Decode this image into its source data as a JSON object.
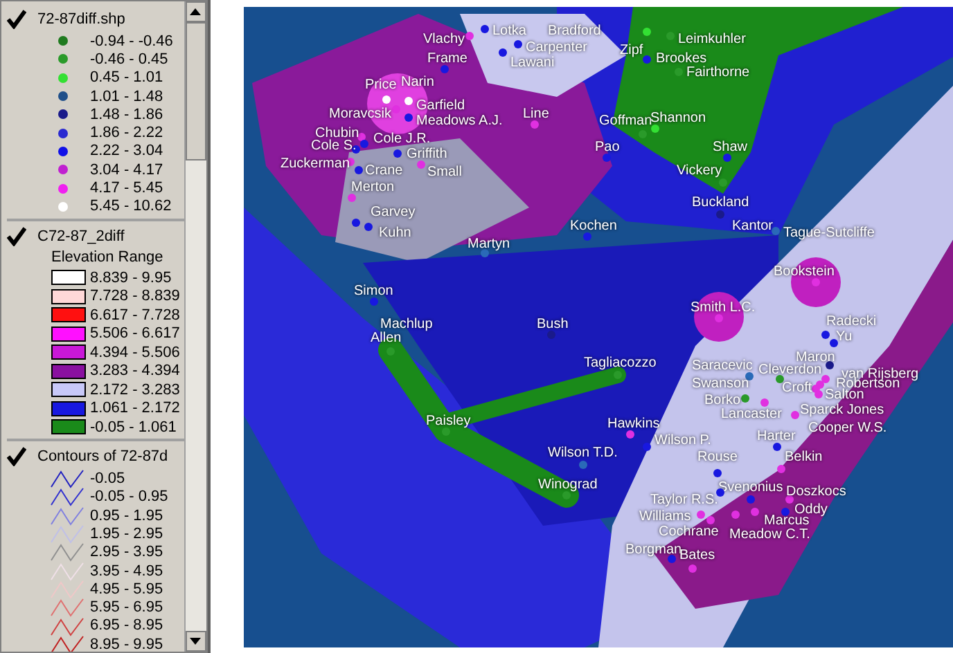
{
  "legend": {
    "layers": [
      {
        "kind": "points",
        "title": "72-87diff.shp",
        "checked": true,
        "items": [
          {
            "label": "-0.94 - -0.46",
            "color": "#1f7a1f"
          },
          {
            "label": "-0.46 - 0.45",
            "color": "#2a9a2a"
          },
          {
            "label": "0.45 - 1.01",
            "color": "#33e033"
          },
          {
            "label": "1.01 - 1.48",
            "color": "#1f4f8a"
          },
          {
            "label": "1.48 - 1.86",
            "color": "#1a1a8a"
          },
          {
            "label": "1.86 - 2.22",
            "color": "#2a2ad0"
          },
          {
            "label": "2.22 - 3.04",
            "color": "#1010e8"
          },
          {
            "label": "3.04 - 4.17",
            "color": "#c020d0"
          },
          {
            "label": "4.17 - 5.45",
            "color": "#f020f0"
          },
          {
            "label": "5.45 - 10.62",
            "color": "#ffffff"
          }
        ]
      },
      {
        "kind": "fills",
        "title": "C72-87_2diff",
        "subtitle": "Elevation Range",
        "checked": true,
        "items": [
          {
            "label": "8.839 - 9.95",
            "color": "#ffffff"
          },
          {
            "label": "7.728 - 8.839",
            "color": "#ffd8d8"
          },
          {
            "label": "6.617 - 7.728",
            "color": "#ff1010"
          },
          {
            "label": "5.506 - 6.617",
            "color": "#ff10ff"
          },
          {
            "label": "4.394 - 5.506",
            "color": "#c818d8"
          },
          {
            "label": "3.283 - 4.394",
            "color": "#8a10a0"
          },
          {
            "label": "2.172 - 3.283",
            "color": "#c8c8f8"
          },
          {
            "label": "1.061 - 2.172",
            "color": "#1818e0"
          },
          {
            "label": "-0.05 - 1.061",
            "color": "#1a8a1a"
          }
        ]
      },
      {
        "kind": "lines",
        "title": "Contours of 72-87d",
        "checked": true,
        "items": [
          {
            "label": "-0.05",
            "color": "#2020c0"
          },
          {
            "label": "-0.05 - 0.95",
            "color": "#3030d0"
          },
          {
            "label": "0.95 - 1.95",
            "color": "#8080e0"
          },
          {
            "label": "1.95 - 2.95",
            "color": "#c0c0e8"
          },
          {
            "label": "2.95 - 3.95",
            "color": "#909090"
          },
          {
            "label": "3.95 - 4.95",
            "color": "#f0e0e8"
          },
          {
            "label": "4.95 - 5.95",
            "color": "#f0c8c8"
          },
          {
            "label": "5.95 - 6.95",
            "color": "#e07070"
          },
          {
            "label": "6.95 - 8.95",
            "color": "#d04040"
          },
          {
            "label": "8.95 - 9.95",
            "color": "#c02020"
          }
        ]
      }
    ]
  },
  "map": {
    "points": [
      {
        "label": "Lotka",
        "color": "#1818e0"
      },
      {
        "label": "Bradford"
      },
      {
        "label": "Vlachy",
        "color": "#e030e0"
      },
      {
        "label": "Leimkuhler",
        "color": "#2a9a2a"
      },
      {
        "label": "Carpenter",
        "color": "#1818e0"
      },
      {
        "label": "Zipf",
        "color": "#33e033"
      },
      {
        "label": "Frame",
        "color": "#1818e0"
      },
      {
        "label": "Lawani",
        "color": "#1818e0"
      },
      {
        "label": "Brookes",
        "color": "#1818e0"
      },
      {
        "label": "Fairthorne",
        "color": "#2a9a2a"
      },
      {
        "label": "Price",
        "color": "#ffffff"
      },
      {
        "label": "Narin",
        "color": "#ffffff"
      },
      {
        "label": "Garfield"
      },
      {
        "label": "Moravcsik",
        "color": "#e030e0"
      },
      {
        "label": "Line",
        "color": "#e030e0"
      },
      {
        "label": "Meadows A.J.",
        "color": "#1818e0"
      },
      {
        "label": "Goffman",
        "color": "#2a9a2a"
      },
      {
        "label": "Shannon",
        "color": "#33e033"
      },
      {
        "label": "Chubin",
        "color": "#e030e0"
      },
      {
        "label": "Cole S.",
        "color": "#1818e0"
      },
      {
        "label": "Cole J.R.",
        "color": "#1818e0"
      },
      {
        "label": "Pao",
        "color": "#1818e0"
      },
      {
        "label": "Shaw",
        "color": "#1818e0"
      },
      {
        "label": "Griffith",
        "color": "#1818e0"
      },
      {
        "label": "Zuckerman",
        "color": "#e030e0"
      },
      {
        "label": "Crane",
        "color": "#1818e0"
      },
      {
        "label": "Small",
        "color": "#e030e0"
      },
      {
        "label": "Vickery",
        "color": "#2a9a2a"
      },
      {
        "label": "Merton",
        "color": "#e030e0"
      },
      {
        "label": "Buckland",
        "color": "#1a1a8a"
      },
      {
        "label": "Garvey",
        "color": "#1818e0"
      },
      {
        "label": "Kuhn",
        "color": "#1818e0"
      },
      {
        "label": "Kochen",
        "color": "#1818e0"
      },
      {
        "label": "Kantor",
        "color": "#2a6ab8"
      },
      {
        "label": "Tague-Sutcliffe"
      },
      {
        "label": "Martyn",
        "color": "#2a6ab8"
      },
      {
        "label": "Bookstein",
        "color": "#e030e0"
      },
      {
        "label": "Simon",
        "color": "#1818e0"
      },
      {
        "label": "Smith L.C.",
        "color": "#e030e0"
      },
      {
        "label": "Machlup"
      },
      {
        "label": "Bush",
        "color": "#1a1a8a"
      },
      {
        "label": "Radecki",
        "color": "#1818e0"
      },
      {
        "label": "Allen",
        "color": "#2a9a2a"
      },
      {
        "label": "Yu",
        "color": "#1818e0"
      },
      {
        "label": "Maron",
        "color": "#1a1a8a"
      },
      {
        "label": "Tagliacozzo",
        "color": "#2a9a2a"
      },
      {
        "label": "Saracevic",
        "color": "#2a6ab8"
      },
      {
        "label": "Cleverdon",
        "color": "#2a9a2a"
      },
      {
        "label": "van Rijsberg",
        "color": "#e030e0"
      },
      {
        "label": "Swanson"
      },
      {
        "label": "Croft",
        "color": "#e030e0"
      },
      {
        "label": "Robertson",
        "color": "#e030e0"
      },
      {
        "label": "Salton",
        "color": "#e030e0"
      },
      {
        "label": "Borko",
        "color": "#2a9a2a"
      },
      {
        "label": "Paisley",
        "color": "#2a9a2a"
      },
      {
        "label": "Lancaster",
        "color": "#e030e0"
      },
      {
        "label": "Sparck Jones",
        "color": "#e030e0"
      },
      {
        "label": "Hawkins",
        "color": "#e030e0"
      },
      {
        "label": "Cooper W.S."
      },
      {
        "label": "Wilson P.",
        "color": "#1818e0"
      },
      {
        "label": "Harter",
        "color": "#1818e0"
      },
      {
        "label": "Wilson T.D.",
        "color": "#2a6ab8"
      },
      {
        "label": "Rouse",
        "color": "#1818e0"
      },
      {
        "label": "Belkin",
        "color": "#e030e0"
      },
      {
        "label": "Winograd",
        "color": "#2a9a2a"
      },
      {
        "label": "Svenonius",
        "color": "#1818e0"
      },
      {
        "label": "Doszkocs",
        "color": "#e030e0"
      },
      {
        "label": "Taylor R.S.",
        "color": "#1818e0"
      },
      {
        "label": "Oddy",
        "color": "#1818e0"
      },
      {
        "label": "Williams",
        "color": "#e030e0"
      },
      {
        "label": "Marcus",
        "color": "#e030e0"
      },
      {
        "label": "Cochrane",
        "color": "#e030e0"
      },
      {
        "label": "Meadow C.T.",
        "color": "#e030e0"
      },
      {
        "label": "Borgman",
        "color": "#1818e0"
      },
      {
        "label": "Bates",
        "color": "#e030e0"
      }
    ]
  }
}
